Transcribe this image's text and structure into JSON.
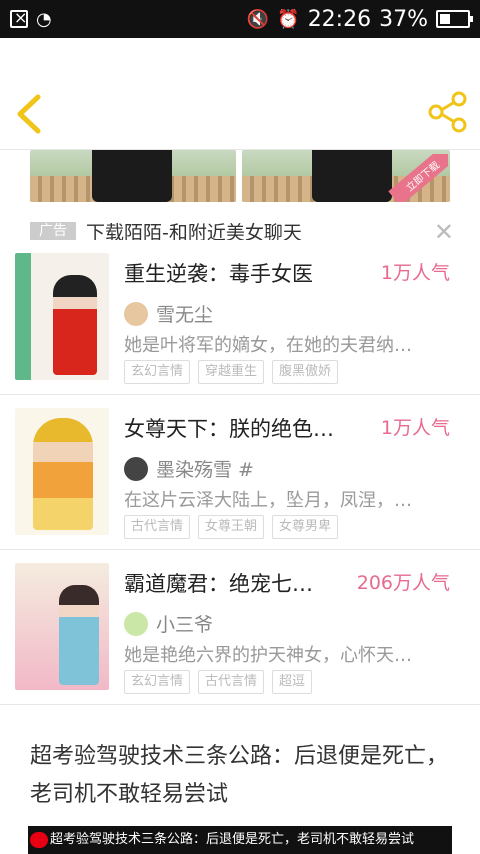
{
  "status": {
    "time": "22:26",
    "battery": "37%"
  },
  "ad": {
    "tag": "广告",
    "text": "下载陌陌-和附近美女聊天",
    "ribbon": "立即下载"
  },
  "books": [
    {
      "title": "重生逆袭：毒手女医",
      "popularity": "1万人气",
      "author": "雪无尘",
      "desc": "她是叶将军的嫡女，在她的夫君纳…",
      "tags": [
        "玄幻言情",
        "穿越重生",
        "腹黑傲娇"
      ]
    },
    {
      "title": "女尊天下：朕的绝色…",
      "popularity": "1万人气",
      "author": "墨染殇雪 #",
      "desc": "在这片云泽大陆上，坠月，凤涅，…",
      "tags": [
        "古代言情",
        "女尊王朝",
        "女尊男卑"
      ]
    },
    {
      "title": "霸道魔君：绝宠七…",
      "popularity": "206万人气",
      "author": "小三爷",
      "desc": "她是艳绝六界的护天神女，心怀天…",
      "tags": [
        "玄幻言情",
        "古代言情",
        "超逗"
      ]
    }
  ],
  "article": {
    "title": "超考验驾驶技术三条公路：后退便是死亡，老司机不敢轻易尝试",
    "banner": "超考验驾驶技术三条公路：后退便是死亡，老司机不敢轻易尝试"
  },
  "colors": {
    "accent": "#e86a8f",
    "icon": "#f0c419"
  }
}
